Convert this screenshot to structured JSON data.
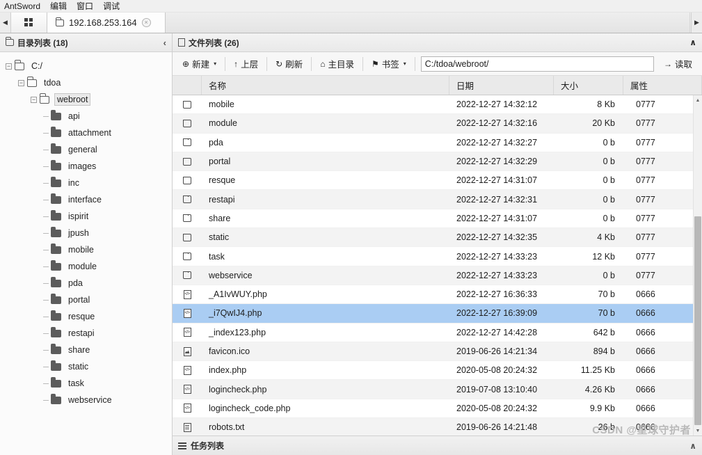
{
  "menubar": {
    "items": [
      "AntSword",
      "编辑",
      "窗口",
      "调试"
    ]
  },
  "tabbar": {
    "prev_arrow": "◀",
    "next_arrow": "▶",
    "grid_button": "grid-view",
    "active_tab": {
      "label": "192.168.253.164",
      "close": "×"
    }
  },
  "left_panel": {
    "title": "目录列表 (18)",
    "collapse": "‹",
    "tree": [
      {
        "label": "C:/",
        "depth": 0,
        "type": "open",
        "expander": "−",
        "selected": false
      },
      {
        "label": "tdoa",
        "depth": 1,
        "type": "open",
        "expander": "−",
        "selected": false
      },
      {
        "label": "webroot",
        "depth": 2,
        "type": "open",
        "expander": "−",
        "selected": true
      },
      {
        "label": "api",
        "depth": 3,
        "type": "solid",
        "expander": "",
        "selected": false
      },
      {
        "label": "attachment",
        "depth": 3,
        "type": "solid",
        "expander": "",
        "selected": false
      },
      {
        "label": "general",
        "depth": 3,
        "type": "solid",
        "expander": "",
        "selected": false
      },
      {
        "label": "images",
        "depth": 3,
        "type": "solid",
        "expander": "",
        "selected": false
      },
      {
        "label": "inc",
        "depth": 3,
        "type": "solid",
        "expander": "",
        "selected": false
      },
      {
        "label": "interface",
        "depth": 3,
        "type": "solid",
        "expander": "",
        "selected": false
      },
      {
        "label": "ispirit",
        "depth": 3,
        "type": "solid",
        "expander": "",
        "selected": false
      },
      {
        "label": "jpush",
        "depth": 3,
        "type": "solid",
        "expander": "",
        "selected": false
      },
      {
        "label": "mobile",
        "depth": 3,
        "type": "solid",
        "expander": "",
        "selected": false
      },
      {
        "label": "module",
        "depth": 3,
        "type": "solid",
        "expander": "",
        "selected": false
      },
      {
        "label": "pda",
        "depth": 3,
        "type": "solid",
        "expander": "",
        "selected": false
      },
      {
        "label": "portal",
        "depth": 3,
        "type": "solid",
        "expander": "",
        "selected": false
      },
      {
        "label": "resque",
        "depth": 3,
        "type": "solid",
        "expander": "",
        "selected": false
      },
      {
        "label": "restapi",
        "depth": 3,
        "type": "solid",
        "expander": "",
        "selected": false
      },
      {
        "label": "share",
        "depth": 3,
        "type": "solid",
        "expander": "",
        "selected": false
      },
      {
        "label": "static",
        "depth": 3,
        "type": "solid",
        "expander": "",
        "selected": false
      },
      {
        "label": "task",
        "depth": 3,
        "type": "solid",
        "expander": "",
        "selected": false
      },
      {
        "label": "webservice",
        "depth": 3,
        "type": "solid",
        "expander": "",
        "selected": false
      }
    ]
  },
  "right_panel": {
    "title": "文件列表 (26)",
    "collapse": "∧",
    "toolbar": {
      "new_label": "新建",
      "new_icon": "⊕",
      "up_label": "上层",
      "up_icon": "↑",
      "refresh_label": "刷新",
      "refresh_icon": "↻",
      "home_label": "主目录",
      "home_icon": "⌂",
      "bookmark_label": "书签",
      "bookmark_icon": "⚑",
      "caret": "▾",
      "path_value": "C:/tdoa/webroot/",
      "path_placeholder": "C:/tdoa/webroot/",
      "read_label": "读取",
      "read_icon": "→"
    },
    "columns": [
      "",
      "名称",
      "日期",
      "大小",
      "属性"
    ],
    "files": [
      {
        "name": "mobile",
        "date": "2022-12-27 14:32:12",
        "size": "8 Kb",
        "attr": "0777",
        "icon": "folder",
        "selected": false
      },
      {
        "name": "module",
        "date": "2022-12-27 14:32:16",
        "size": "20 Kb",
        "attr": "0777",
        "icon": "folder",
        "selected": false
      },
      {
        "name": "pda",
        "date": "2022-12-27 14:32:27",
        "size": "0 b",
        "attr": "0777",
        "icon": "folder",
        "selected": false
      },
      {
        "name": "portal",
        "date": "2022-12-27 14:32:29",
        "size": "0 b",
        "attr": "0777",
        "icon": "folder",
        "selected": false
      },
      {
        "name": "resque",
        "date": "2022-12-27 14:31:07",
        "size": "0 b",
        "attr": "0777",
        "icon": "folder",
        "selected": false
      },
      {
        "name": "restapi",
        "date": "2022-12-27 14:32:31",
        "size": "0 b",
        "attr": "0777",
        "icon": "folder",
        "selected": false
      },
      {
        "name": "share",
        "date": "2022-12-27 14:31:07",
        "size": "0 b",
        "attr": "0777",
        "icon": "folder",
        "selected": false
      },
      {
        "name": "static",
        "date": "2022-12-27 14:32:35",
        "size": "4 Kb",
        "attr": "0777",
        "icon": "folder",
        "selected": false
      },
      {
        "name": "task",
        "date": "2022-12-27 14:33:23",
        "size": "12 Kb",
        "attr": "0777",
        "icon": "folder",
        "selected": false
      },
      {
        "name": "webservice",
        "date": "2022-12-27 14:33:23",
        "size": "0 b",
        "attr": "0777",
        "icon": "folder",
        "selected": false
      },
      {
        "name": "_A1IvWUY.php",
        "date": "2022-12-27 16:36:33",
        "size": "70 b",
        "attr": "0666",
        "icon": "code",
        "selected": false
      },
      {
        "name": "_i7QwIJ4.php",
        "date": "2022-12-27 16:39:09",
        "size": "70 b",
        "attr": "0666",
        "icon": "code",
        "selected": true
      },
      {
        "name": "_index123.php",
        "date": "2022-12-27 14:42:28",
        "size": "642 b",
        "attr": "0666",
        "icon": "code",
        "selected": false
      },
      {
        "name": "favicon.ico",
        "date": "2019-06-26 14:21:34",
        "size": "894 b",
        "attr": "0666",
        "icon": "img",
        "selected": false
      },
      {
        "name": "index.php",
        "date": "2020-05-08 20:24:32",
        "size": "11.25 Kb",
        "attr": "0666",
        "icon": "code",
        "selected": false
      },
      {
        "name": "logincheck.php",
        "date": "2019-07-08 13:10:40",
        "size": "4.26 Kb",
        "attr": "0666",
        "icon": "code",
        "selected": false
      },
      {
        "name": "logincheck_code.php",
        "date": "2020-05-08 20:24:32",
        "size": "9.9 Kb",
        "attr": "0666",
        "icon": "code",
        "selected": false
      },
      {
        "name": "robots.txt",
        "date": "2019-06-26 14:21:48",
        "size": "26 b",
        "attr": "0666",
        "icon": "txt",
        "selected": false
      }
    ],
    "scroll": {
      "up_arrow": "▲",
      "down_arrow": "▼"
    }
  },
  "bottom_bar": {
    "title": "任务列表",
    "collapse": "∧"
  },
  "watermark": "CSDN @星球守护者",
  "colors": {
    "selection": "#aacdf3",
    "row_alt": "#f3f3f3",
    "chrome": "#f0f0f0"
  }
}
